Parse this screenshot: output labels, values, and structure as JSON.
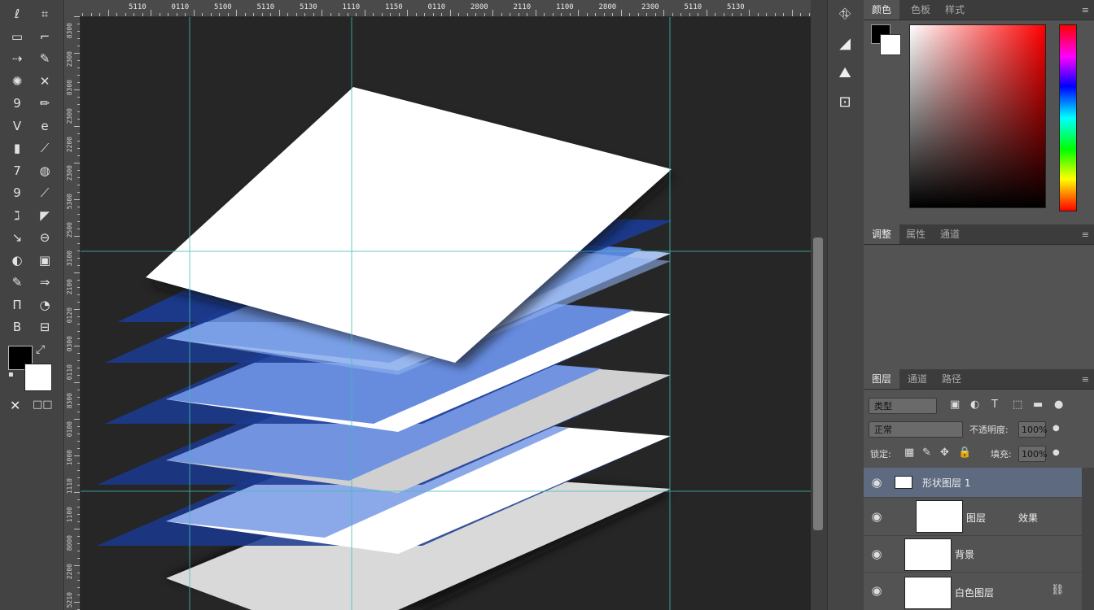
{
  "toolbar": {
    "tools": [
      {
        "name": "lasso-tool",
        "glyph": "ℓ"
      },
      {
        "name": "marquee-alt-tool",
        "glyph": "⌗"
      },
      {
        "name": "rect-select-tool",
        "glyph": "▭"
      },
      {
        "name": "crop-tool",
        "glyph": "⌐"
      },
      {
        "name": "transform-tool",
        "glyph": "⇢"
      },
      {
        "name": "quick-select-tool",
        "glyph": "✎"
      },
      {
        "name": "healing-tool",
        "glyph": "✺"
      },
      {
        "name": "patch-tool",
        "glyph": "✕"
      },
      {
        "name": "brush-tool",
        "glyph": "9"
      },
      {
        "name": "pencil-tool",
        "glyph": "✏"
      },
      {
        "name": "clone-stamp-tool",
        "glyph": "V"
      },
      {
        "name": "history-brush-tool",
        "glyph": "e"
      },
      {
        "name": "eraser-tool",
        "glyph": "▮"
      },
      {
        "name": "bg-eraser-tool",
        "glyph": "⟋"
      },
      {
        "name": "gradient-tool",
        "glyph": "7"
      },
      {
        "name": "blur-tool",
        "glyph": "◍"
      },
      {
        "name": "dodge-tool",
        "glyph": "9"
      },
      {
        "name": "burn-tool",
        "glyph": "⟋"
      },
      {
        "name": "pen-tool",
        "glyph": "ℷ"
      },
      {
        "name": "freeform-pen-tool",
        "glyph": "◤"
      },
      {
        "name": "type-tool",
        "glyph": "↘"
      },
      {
        "name": "vertical-type-tool",
        "glyph": "⊖"
      },
      {
        "name": "path-select-tool",
        "glyph": "◐"
      },
      {
        "name": "direct-select-tool",
        "glyph": "▣"
      },
      {
        "name": "shape-tool",
        "glyph": "✎"
      },
      {
        "name": "custom-shape-tool",
        "glyph": "⇒"
      },
      {
        "name": "hand-tool",
        "glyph": "Π"
      },
      {
        "name": "rotate-view-tool",
        "glyph": "◔"
      },
      {
        "name": "zoom-tool",
        "glyph": "B"
      },
      {
        "name": "edit-toolbar-tool",
        "glyph": "⊟"
      }
    ],
    "mini_left": "✕",
    "mini_right": "□□",
    "fg_color": "#000000",
    "bg_color": "#ffffff"
  },
  "ruler": {
    "top_labels": [
      "5110",
      "0110",
      "5100",
      "5110",
      "5130",
      "1110",
      "1150",
      "0110",
      "2800",
      "2110",
      "1100",
      "2800",
      "2300",
      "5110",
      "5130"
    ],
    "left_labels": [
      "8300",
      "2300",
      "8300",
      "2300",
      "2200",
      "2300",
      "5300",
      "2500",
      "3100",
      "2100",
      "0120",
      "0300",
      "0110",
      "8300",
      "0100",
      "1000",
      "1110",
      "1100",
      "8000",
      "2200",
      "5210"
    ]
  },
  "canvas": {
    "background": "#262626",
    "guide_color": "#3fbfb8"
  },
  "strip": {
    "icons": [
      {
        "name": "histogram-icon",
        "glyph": "⛗"
      },
      {
        "name": "paragraph-icon",
        "glyph": "◢"
      },
      {
        "name": "navigator-icon",
        "glyph": "⛰"
      },
      {
        "name": "clone-source-icon",
        "glyph": "⊡"
      }
    ]
  },
  "color_panel": {
    "tabs": [
      "颜色",
      "色板",
      "样式"
    ],
    "fg": "#000000",
    "bg": "#ffffff"
  },
  "adjust_panel": {
    "tabs": [
      "调整",
      "属性",
      "通道"
    ]
  },
  "layers_panel": {
    "tabs": [
      "图层",
      "通道",
      "路径"
    ],
    "filter_kind": "类型",
    "blend_mode": "正常",
    "opacity_label": "不透明度:",
    "opacity_value": "100%",
    "lock_label": "锁定:",
    "fill_label": "填充:",
    "fill_value": "100%",
    "layers": [
      {
        "name": "形状图层 1",
        "selected": true
      },
      {
        "name": "图层",
        "extra": "效果",
        "selected": false
      },
      {
        "name": "背景",
        "selected": false
      },
      {
        "name": "白色图层",
        "selected": false
      }
    ]
  }
}
